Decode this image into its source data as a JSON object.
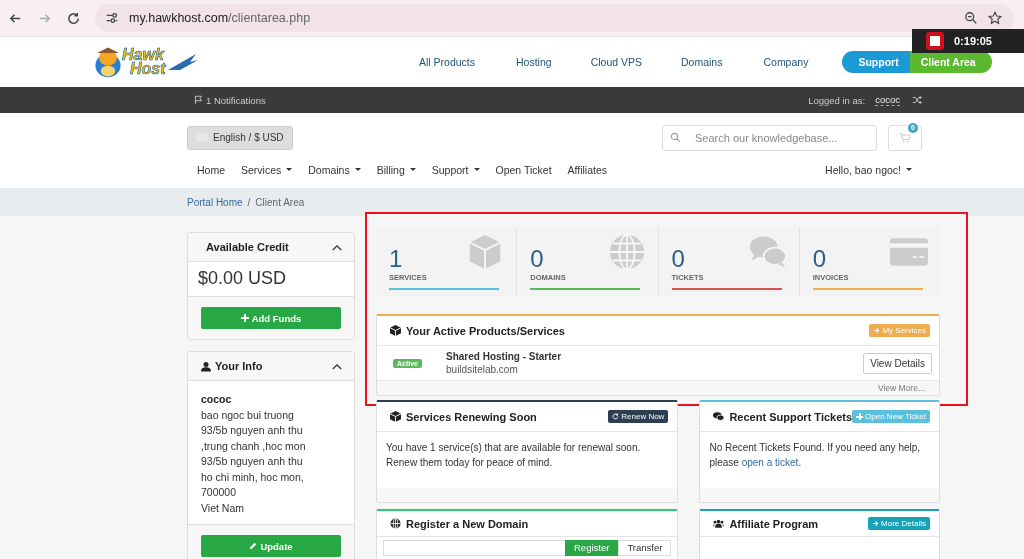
{
  "browser": {
    "url_host": "my.hawkhost.com",
    "url_path": "/clientarea.php"
  },
  "recorder": {
    "time": "0:19:05"
  },
  "logo": {
    "line1": "Hawk",
    "line2": "Host"
  },
  "main_nav": [
    "All Products",
    "Hosting",
    "Cloud VPS",
    "Domains",
    "Company"
  ],
  "header_buttons": [
    {
      "label": "Support",
      "kind": "support"
    },
    {
      "label": "Client Area",
      "kind": "client"
    }
  ],
  "top_bar": {
    "notifications": "1 Notifications",
    "logged_in_label": "Logged in as:",
    "username": "cococ"
  },
  "language_button": "English / $ USD",
  "search": {
    "placeholder": "Search our knowledgebase..."
  },
  "cart": {
    "count": "0"
  },
  "menu": [
    {
      "label": "Home",
      "dropdown": false
    },
    {
      "label": "Services",
      "dropdown": true
    },
    {
      "label": "Domains",
      "dropdown": true
    },
    {
      "label": "Billing",
      "dropdown": true
    },
    {
      "label": "Support",
      "dropdown": true
    },
    {
      "label": "Open Ticket",
      "dropdown": false
    },
    {
      "label": "Affiliates",
      "dropdown": false
    }
  ],
  "user_menu": {
    "label": "Hello, bao ngoc!"
  },
  "breadcrumb_separator": "/",
  "breadcrumb": [
    {
      "label": "Portal Home",
      "link": true
    },
    {
      "label": "Client Area",
      "link": false
    }
  ],
  "sidebar": {
    "credit": {
      "title": "Available Credit",
      "amount": "$0.00 USD",
      "button": "Add Funds"
    },
    "info": {
      "title": "Your Info",
      "name": "cococ",
      "lines": [
        "bao ngoc bui truong",
        "93/5b nguyen anh thu",
        ",trung chanh ,hoc mon",
        "93/5b nguyen anh thu",
        "ho chi minh, hoc mon,",
        "700000",
        "Viet Nam"
      ],
      "button": "Update"
    }
  },
  "stats": [
    {
      "count": "1",
      "label": "SERVICES",
      "color": "#5bc0de",
      "kind": "box"
    },
    {
      "count": "0",
      "label": "DOMAINS",
      "color": "#5cb85c",
      "kind": "globe"
    },
    {
      "count": "0",
      "label": "TICKETS",
      "color": "#d9534f",
      "kind": "chat"
    },
    {
      "count": "0",
      "label": "INVOICES",
      "color": "#f0ad4e",
      "kind": "card"
    }
  ],
  "active_products": {
    "title": "Your Active Products/Services",
    "button": "My Services",
    "items": [
      {
        "status": "Active",
        "name": "Shared Hosting - Starter",
        "domain": "buildsitelab.com",
        "button": "View Details"
      }
    ],
    "footer": "View More..."
  },
  "panels": [
    {
      "kind": "renew",
      "title": "Services Renewing Soon",
      "button": "Renew Now",
      "text": "You have 1 service(s) that are available for renewal soon. Renew them today for peace of mind.",
      "color": "#2c3e50"
    },
    {
      "kind": "tickets",
      "title": "Recent Support Tickets",
      "button": "Open New Ticket",
      "text": "No Recent Tickets Found. If you need any help, please ",
      "link": "open a ticket",
      "after": ".",
      "color": "#5bc0de"
    },
    {
      "kind": "domain",
      "title": "Register a New Domain",
      "tabs": [
        {
          "label": "Register",
          "selected": true
        },
        {
          "label": "Transfer",
          "selected": false
        }
      ],
      "color": "#2ecc71"
    },
    {
      "kind": "affiliate",
      "title": "Affiliate Program",
      "button": "More Details",
      "color": "#17a2b8"
    }
  ]
}
